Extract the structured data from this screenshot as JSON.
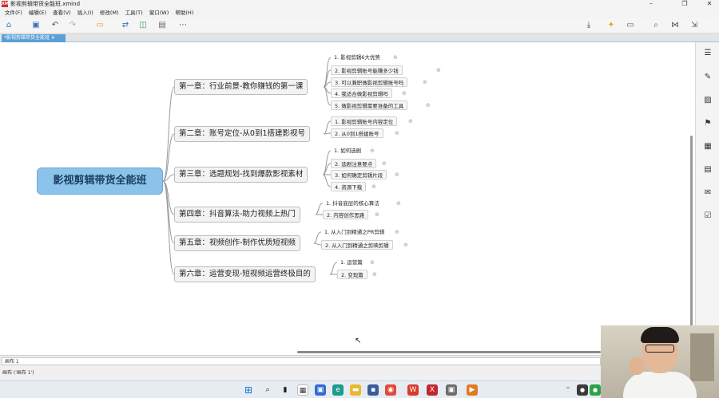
{
  "window": {
    "app_icon_text": "XM",
    "title": "影视剪辑带货全能班.xmind",
    "min": "–",
    "restore": "❐",
    "close": "✕"
  },
  "menu": [
    "文件(F)",
    "编辑(E)",
    "查看(V)",
    "插入(I)",
    "修改(M)",
    "工具(T)",
    "窗口(W)",
    "帮助(H)"
  ],
  "tab": {
    "label": "*影视剪辑带货全能班 ✕"
  },
  "mindmap": {
    "root": "影视剪辑带货全能班",
    "chapters": [
      {
        "title": "第一章：行业前景-教你赚钱的第一课",
        "items": [
          "1. 影视剪辑6大优势",
          "2. 影视剪辑账号能赚多少钱",
          "3. 可以兼职做影视剪辑账号吗",
          "4. 我适合做影视剪辑吗",
          "5. 做影视剪辑需要准备的工具"
        ]
      },
      {
        "title": "第二章：账号定位-从0到1搭建影视号",
        "items": [
          "1. 影视剪辑账号内容定位",
          "2. 从0到1搭建账号"
        ]
      },
      {
        "title": "第三章：选题规划-找到爆款影视素材",
        "items": [
          "1. 如何选剧",
          "2. 选剧注意要点",
          "3. 如何确定剪辑片段",
          "4. 资源下载"
        ]
      },
      {
        "title": "第四章：抖音算法-助力视频上热门",
        "items": [
          "1. 抖音底层的核心算法",
          "2. 内容创作思路"
        ]
      },
      {
        "title": "第五章：视频创作-制作优质短视频",
        "items": [
          "1. 从入门到精通之PR剪辑",
          "2. 从入门到精通之剪映剪辑"
        ]
      },
      {
        "title": "第六章：运营变现-短视频运营终极目的",
        "items": [
          "1. 运营篇",
          "2. 变现篇"
        ]
      }
    ]
  },
  "sheet": {
    "name": "画布 1"
  },
  "status": {
    "text": "画布 ('画布 1')"
  }
}
